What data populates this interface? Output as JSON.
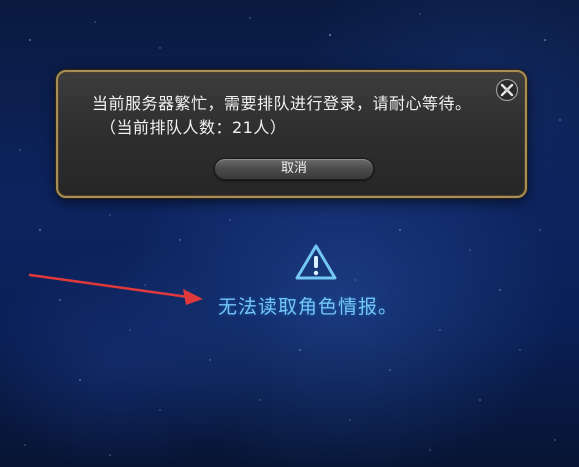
{
  "dialog": {
    "message_line1": "当前服务器繁忙，需要排队进行登录，请耐心等待。",
    "message_line2": "（当前排队人数：21人）",
    "cancel_label": "取消",
    "close_icon": "close-icon"
  },
  "status": {
    "warning_icon": "warning-icon",
    "error_text": "无法读取角色情报。"
  },
  "annotation": {
    "arrow_color": "#e0393b"
  },
  "colors": {
    "dialog_border": "#a78e57",
    "error_text": "#74c7f2",
    "background": "#0d2460"
  }
}
